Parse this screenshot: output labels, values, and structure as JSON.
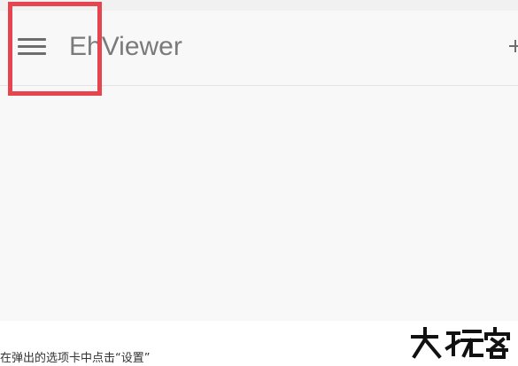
{
  "toolbar": {
    "title": "EhViewer",
    "menu_icon": "hamburger-menu-icon",
    "action_icon": "add-icon"
  },
  "annotation": {
    "highlight_color": "#e6454f"
  },
  "caption": {
    "text": "在弹出的选项卡中点击“设置”"
  },
  "watermark": {
    "text": "大玩客"
  },
  "colors": {
    "screen_background": "#f8f8f8",
    "toolbar_text": "#7a7a7a",
    "icon": "#6e6e6e"
  }
}
